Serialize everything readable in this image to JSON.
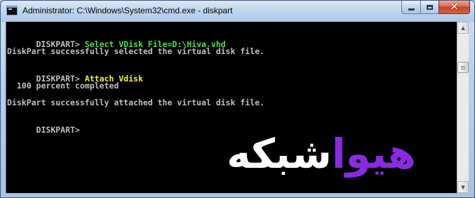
{
  "window": {
    "title": "Administrator: C:\\Windows\\System32\\cmd.exe - diskpart",
    "buttons": {
      "minimize": "minimize-icon",
      "maximize": "maximize-icon",
      "close": "close-icon",
      "close_glyph": "✕"
    }
  },
  "console": {
    "lines": [
      {
        "prompt": "DISKPART> ",
        "command": "Select VDisk File=D:\\Hiva.vhd",
        "command_color": "#3ee83e"
      },
      {
        "text": "DiskPart successfully selected the virtual disk file."
      },
      {
        "prompt": "DISKPART> ",
        "command": "Attach Vdisk",
        "command_color": "#f2f23a"
      },
      {
        "text": "  100 percent completed"
      },
      {
        "text": "DiskPart successfully attached the virtual disk file."
      },
      {
        "prompt": "DISKPART> ",
        "command": ""
      }
    ],
    "background": "#000000",
    "text_color": "#c0c0c0"
  },
  "watermark": {
    "text": "هیواشبکه",
    "colors": {
      "purple": "#8a2be2",
      "white": "#ffffff"
    }
  }
}
